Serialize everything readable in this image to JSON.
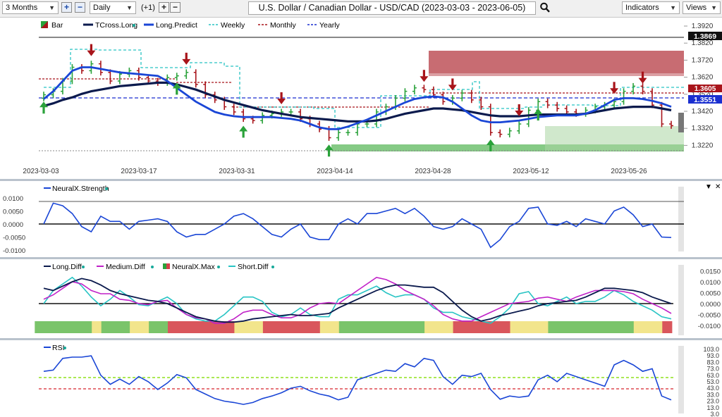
{
  "toolbar": {
    "range": "3 Months",
    "interval": "Daily",
    "offset": "(+1)",
    "title": "U.S. Dollar / Canadian Dollar - USD/CAD (2023-03-03 - 2023-06-05)",
    "indicators": "Indicators",
    "views": "Views"
  },
  "main_chart": {
    "legend": [
      "Bar",
      "TCross.Long",
      "Long.Predict",
      "Weekly",
      "Monthly",
      "Yearly"
    ],
    "price_ticks": [
      "1.3920",
      "1.3820",
      "1.3720",
      "1.3620",
      "1.3520",
      "1.3420",
      "1.3320",
      "1.3220"
    ],
    "price_labels": {
      "level_top": "1.3869",
      "level_red": "1.3605",
      "level_blue": "1.3551"
    },
    "date_ticks": [
      "2023-03-03",
      "2023-03-17",
      "2023-03-31",
      "2023-04-14",
      "2023-04-28",
      "2023-05-12",
      "2023-05-26"
    ]
  },
  "strength_panel": {
    "legend": "NeuralX.Strength",
    "ticks": [
      "0.0100",
      "0.0050",
      "0.0000",
      "-0.0050",
      "-0.0100"
    ]
  },
  "diff_panel": {
    "legend": [
      "Long.Diff",
      "Medium.Diff",
      "NeuralX.Max",
      "Short.Diff"
    ],
    "ticks": [
      "0.0150",
      "0.0100",
      "0.0050",
      "0.0000",
      "-0.0050",
      "-0.0100"
    ]
  },
  "rsi_panel": {
    "legend": "RSI",
    "ticks": [
      "103.0",
      "93.0",
      "83.0",
      "73.0",
      "63.0",
      "53.0",
      "43.0",
      "33.0",
      "23.0",
      "13.0",
      "3.0"
    ]
  },
  "colors": {
    "blue": "#1a46d6",
    "navy": "#0b1a4d",
    "green": "#2aa23a",
    "red": "#a8141a",
    "cyan": "#28c4c4",
    "magenta": "#c020c8"
  },
  "chart_data": [
    {
      "type": "bar",
      "title": "U.S. Dollar / Canadian Dollar - USD/CAD (2023-03-03 - 2023-06-05)",
      "x": [
        "2023-03-03",
        "2023-03-06",
        "2023-03-07",
        "2023-03-08",
        "2023-03-09",
        "2023-03-10",
        "2023-03-13",
        "2023-03-14",
        "2023-03-15",
        "2023-03-16",
        "2023-03-17",
        "2023-03-20",
        "2023-03-21",
        "2023-03-22",
        "2023-03-23",
        "2023-03-24",
        "2023-03-27",
        "2023-03-28",
        "2023-03-29",
        "2023-03-30",
        "2023-03-31",
        "2023-04-03",
        "2023-04-04",
        "2023-04-05",
        "2023-04-06",
        "2023-04-07",
        "2023-04-10",
        "2023-04-11",
        "2023-04-12",
        "2023-04-13",
        "2023-04-14",
        "2023-04-17",
        "2023-04-18",
        "2023-04-19",
        "2023-04-20",
        "2023-04-21",
        "2023-04-24",
        "2023-04-25",
        "2023-04-26",
        "2023-04-27",
        "2023-04-28",
        "2023-05-01",
        "2023-05-02",
        "2023-05-03",
        "2023-05-04",
        "2023-05-05",
        "2023-05-08",
        "2023-05-09",
        "2023-05-10",
        "2023-05-11",
        "2023-05-12",
        "2023-05-15",
        "2023-05-16",
        "2023-05-17",
        "2023-05-18",
        "2023-05-19",
        "2023-05-22",
        "2023-05-23",
        "2023-05-24",
        "2023-05-25",
        "2023-05-26",
        "2023-05-29",
        "2023-05-30",
        "2023-05-31",
        "2023-06-01",
        "2023-06-02",
        "2023-06-05"
      ],
      "close": [
        1.362,
        1.364,
        1.37,
        1.378,
        1.376,
        1.38,
        1.375,
        1.37,
        1.374,
        1.376,
        1.372,
        1.37,
        1.369,
        1.372,
        1.373,
        1.375,
        1.368,
        1.362,
        1.359,
        1.355,
        1.352,
        1.348,
        1.347,
        1.35,
        1.351,
        1.352,
        1.352,
        1.348,
        1.345,
        1.342,
        1.337,
        1.34,
        1.34,
        1.345,
        1.345,
        1.352,
        1.355,
        1.36,
        1.364,
        1.366,
        1.365,
        1.362,
        1.358,
        1.36,
        1.363,
        1.359,
        1.355,
        1.34,
        1.339,
        1.341,
        1.345,
        1.353,
        1.358,
        1.356,
        1.354,
        1.352,
        1.351,
        1.353,
        1.355,
        1.356,
        1.358,
        1.364,
        1.367,
        1.364,
        1.356,
        1.345,
        1.344
      ],
      "series": [
        {
          "name": "TCross.Long",
          "values": [
            1.3555,
            1.357,
            1.359,
            1.3605,
            1.3625,
            1.364,
            1.365,
            1.366,
            1.367,
            1.3675,
            1.368,
            1.3685,
            1.369,
            1.369,
            1.368,
            1.3665,
            1.365,
            1.363,
            1.361,
            1.359,
            1.3575,
            1.356,
            1.3545,
            1.353,
            1.352,
            1.351,
            1.35,
            1.349,
            1.3485,
            1.348,
            1.3475,
            1.347,
            1.3465,
            1.3465,
            1.3465,
            1.347,
            1.348,
            1.3495,
            1.351,
            1.352,
            1.353,
            1.354,
            1.354,
            1.3535,
            1.353,
            1.352,
            1.351,
            1.35,
            1.3495,
            1.3495,
            1.3495,
            1.35,
            1.3505,
            1.3505,
            1.3505,
            1.3505,
            1.3505,
            1.351,
            1.352,
            1.353,
            1.354,
            1.3545,
            1.355,
            1.355,
            1.355,
            1.354,
            1.353
          ]
        },
        {
          "name": "Long.Predict",
          "values": [
            1.3595,
            1.364,
            1.37,
            1.376,
            1.378,
            1.378,
            1.377,
            1.376,
            1.375,
            1.3745,
            1.374,
            1.3735,
            1.373,
            1.37,
            1.366,
            1.362,
            1.358,
            1.355,
            1.352,
            1.3505,
            1.3495,
            1.349,
            1.349,
            1.349,
            1.349,
            1.3485,
            1.348,
            1.347,
            1.345,
            1.343,
            1.342,
            1.342,
            1.3435,
            1.3455,
            1.3475,
            1.35,
            1.3525,
            1.355,
            1.3575,
            1.3595,
            1.3605,
            1.361,
            1.3605,
            1.358,
            1.354,
            1.35,
            1.347,
            1.346,
            1.346,
            1.3465,
            1.347,
            1.348,
            1.349,
            1.3495,
            1.35,
            1.35,
            1.35,
            1.351,
            1.353,
            1.356,
            1.359,
            1.36,
            1.36,
            1.3595,
            1.3585,
            1.357,
            1.355
          ]
        }
      ],
      "ylim": [
        1.32,
        1.395
      ]
    },
    {
      "type": "line",
      "series": [
        {
          "name": "NeuralX.Strength",
          "values": [
            0.0,
            0.008,
            0.007,
            0.004,
            -0.001,
            -0.003,
            0.003,
            0.001,
            0.001,
            -0.002,
            0.001,
            0.0015,
            0.002,
            0.001,
            -0.003,
            -0.005,
            -0.004,
            -0.004,
            -0.002,
            0.0,
            0.003,
            0.004,
            0.002,
            -0.001,
            -0.004,
            -0.005,
            -0.002,
            0.0,
            -0.005,
            -0.006,
            -0.006,
            0.0,
            0.002,
            0.0,
            0.004,
            0.004,
            0.005,
            0.006,
            0.004,
            0.006,
            0.003,
            -0.001,
            -0.002,
            -0.001,
            0.002,
            0.0,
            -0.002,
            -0.009,
            -0.006,
            -0.001,
            0.001,
            0.006,
            0.0065,
            0.0,
            -0.0005,
            0.001,
            -0.001,
            0.002,
            0.001,
            0.0,
            0.005,
            0.0065,
            0.0035,
            -0.001,
            0.0,
            -0.005,
            -0.0052
          ]
        }
      ],
      "ylim": [
        -0.012,
        0.011
      ]
    },
    {
      "type": "line",
      "series": [
        {
          "name": "Long.Diff",
          "values": [
            0.007,
            0.006,
            0.008,
            0.01,
            0.0115,
            0.0105,
            0.0085,
            0.006,
            0.0045,
            0.0035,
            0.0025,
            0.0015,
            0.001,
            0.0,
            -0.002,
            -0.004,
            -0.006,
            -0.007,
            -0.008,
            -0.0085,
            -0.0085,
            -0.008,
            -0.007,
            -0.0065,
            -0.006,
            -0.0055,
            -0.005,
            -0.0055,
            -0.0055,
            -0.005,
            -0.0045,
            -0.002,
            0.0,
            0.002,
            0.004,
            0.006,
            0.0075,
            0.0085,
            0.0085,
            0.008,
            0.0075,
            0.0075,
            0.005,
            0.001,
            -0.003,
            -0.006,
            -0.008,
            -0.007,
            -0.0055,
            -0.0045,
            -0.0035,
            -0.0025,
            -0.001,
            0.0,
            0.0005,
            0.001,
            0.0015,
            0.003,
            0.005,
            0.007,
            0.007,
            0.0065,
            0.006,
            0.005,
            0.003,
            0.0015,
            0.0
          ]
        },
        {
          "name": "Medium.Diff",
          "values": [
            0.002,
            0.004,
            0.007,
            0.01,
            0.009,
            0.006,
            0.0045,
            0.0045,
            0.002,
            0.0015,
            0.0,
            -0.0005,
            0.001,
            0.0015,
            -0.002,
            -0.005,
            -0.0065,
            -0.007,
            -0.009,
            -0.009,
            -0.007,
            -0.004,
            -0.003,
            -0.003,
            -0.005,
            -0.0065,
            -0.0065,
            -0.005,
            -0.002,
            0.0,
            0.0005,
            0.0,
            0.003,
            0.006,
            0.009,
            0.012,
            0.011,
            0.009,
            0.006,
            0.004,
            0.002,
            -0.001,
            -0.005,
            -0.007,
            -0.008,
            -0.008,
            -0.006,
            -0.004,
            -0.002,
            0.0,
            0.0005,
            0.001,
            0.0025,
            0.003,
            0.002,
            0.001,
            0.003,
            0.0045,
            0.006,
            0.006,
            0.006,
            0.0055,
            0.0045,
            0.002,
            0.0,
            -0.002,
            -0.0045
          ]
        },
        {
          "name": "Short.Diff",
          "values": [
            0.0,
            0.006,
            0.009,
            0.012,
            0.008,
            0.003,
            -0.001,
            0.002,
            0.006,
            0.003,
            -0.0005,
            -0.001,
            0.001,
            0.003,
            0.0,
            -0.005,
            -0.007,
            -0.008,
            -0.008,
            -0.005,
            -0.001,
            0.003,
            0.003,
            0.001,
            -0.004,
            -0.006,
            -0.005,
            -0.002,
            -0.005,
            -0.006,
            -0.006,
            0.002,
            0.004,
            0.004,
            0.006,
            0.008,
            0.005,
            0.003,
            0.004,
            0.004,
            0.002,
            -0.002,
            -0.004,
            -0.004,
            -0.006,
            -0.007,
            -0.008,
            -0.009,
            -0.006,
            -0.002,
            0.0045,
            0.0055,
            0.0,
            -0.001,
            0.001,
            0.003,
            0.0,
            0.001,
            0.001,
            0.003,
            0.006,
            0.004,
            0.001,
            -0.001,
            -0.003,
            -0.006,
            -0.007
          ]
        }
      ],
      "ylim": [
        -0.013,
        0.016
      ]
    },
    {
      "type": "line",
      "series": [
        {
          "name": "RSI",
          "values": [
            68,
            70,
            88,
            90,
            90,
            92,
            62,
            48,
            56,
            48,
            60,
            52,
            40,
            50,
            63,
            58,
            40,
            33,
            26,
            22,
            20,
            17,
            20,
            26,
            30,
            35,
            42,
            45,
            38,
            33,
            30,
            24,
            28,
            55,
            60,
            65,
            70,
            68,
            80,
            75,
            88,
            85,
            60,
            48,
            62,
            60,
            65,
            40,
            25,
            30,
            28,
            30,
            55,
            62,
            52,
            65,
            60,
            55,
            50,
            45,
            78,
            85,
            78,
            68,
            72,
            30,
            24
          ]
        }
      ],
      "ylim": [
        3,
        103
      ]
    }
  ]
}
